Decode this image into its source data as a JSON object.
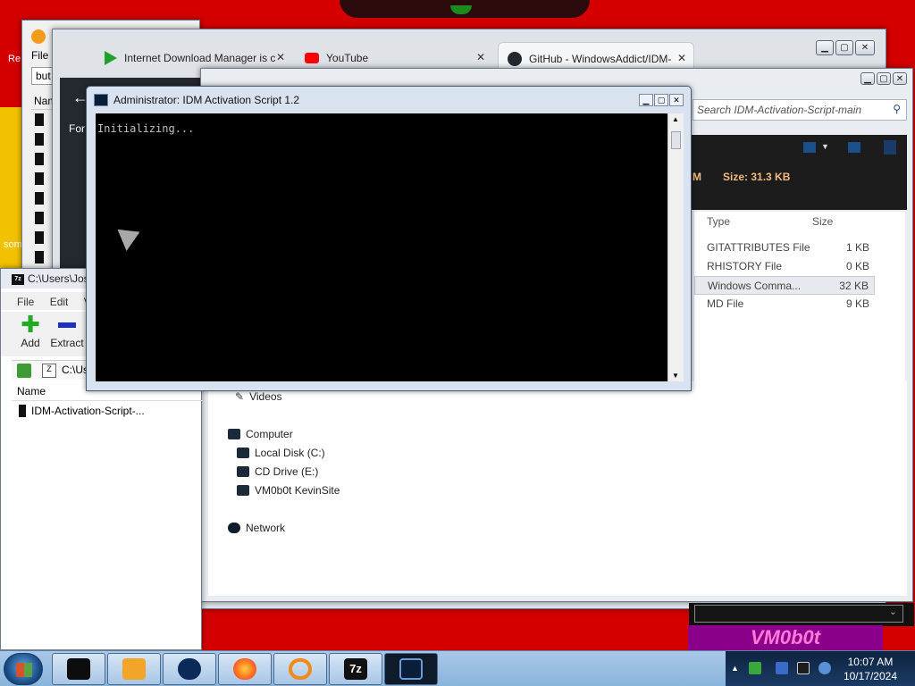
{
  "desktop": {
    "corner_label": "Re",
    "side_label": "som",
    "banner": "VM0b0t"
  },
  "idm_window": {
    "menu_label": "File",
    "search_value": "but",
    "column_name": "Nam"
  },
  "browser": {
    "tabs": [
      {
        "label": "Internet Download Manager is c",
        "icon": "idm-play-icon"
      },
      {
        "label": "YouTube",
        "icon": "youtube-icon"
      },
      {
        "label": "GitHub - WindowsAddict/IDM-",
        "icon": "github-icon"
      }
    ],
    "back_glyph": "←",
    "dark_text": "For"
  },
  "explorer": {
    "search_placeholder": "Search IDM-Activation-Script-main",
    "size_prefix": "M",
    "size_label": "Size: 31.3 KB",
    "columns": {
      "type": "Type",
      "size": "Size"
    },
    "files": [
      {
        "type": "GITATTRIBUTES File",
        "size": "1 KB"
      },
      {
        "type": "RHISTORY File",
        "size": "0 KB"
      },
      {
        "type": "Windows Comma...",
        "size": "32 KB"
      },
      {
        "type": "MD File",
        "size": "9 KB"
      }
    ],
    "nav": {
      "videos": "Videos",
      "computer": "Computer",
      "local_disk": "Local Disk (C:)",
      "cd_drive": "CD Drive (E:)",
      "share": "VM0b0t KevinSite",
      "network": "Network"
    }
  },
  "sevenzip": {
    "title": "C:\\Users\\Jos",
    "menu": [
      "File",
      "Edit",
      "Vi"
    ],
    "tools": {
      "add": "Add",
      "extract": "Extract"
    },
    "address": "C:\\Us",
    "column_name": "Name",
    "file": "IDM-Activation-Script-..."
  },
  "cmd": {
    "title": "Administrator:  IDM Activation Script 1.2",
    "output": "Initializing..."
  },
  "taskbar": {
    "clock_time": "10:07 AM",
    "clock_date": "10/17/2024"
  },
  "colors": {
    "desktop_red": "#d40000",
    "taskbar_blue": "#a8c8e8",
    "console_bg": "#000000"
  }
}
